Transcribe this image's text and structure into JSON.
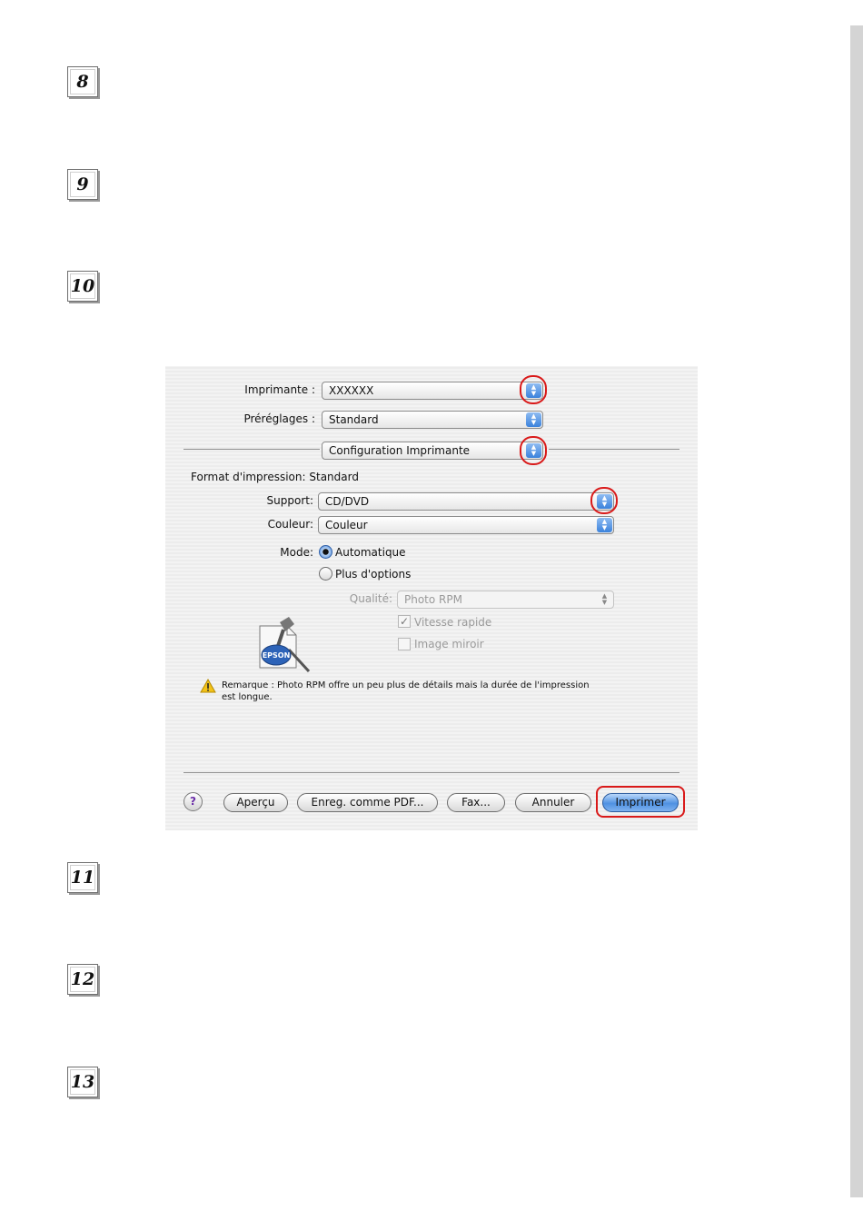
{
  "steps": {
    "s8": "8",
    "s9": "9",
    "s10": "10",
    "s11": "11",
    "s12": "12",
    "s13": "13"
  },
  "dialog": {
    "printer_label": "Imprimante :",
    "printer_value": "XXXXXX",
    "presets_label": "Préréglages :",
    "presets_value": "Standard",
    "panel_value": "Configuration Imprimante",
    "format_label": "Format d'impression:",
    "format_value": "Standard",
    "support_label": "Support:",
    "support_value": "CD/DVD",
    "color_label": "Couleur:",
    "color_value": "Couleur",
    "mode_label": "Mode:",
    "mode_auto": "Automatique",
    "mode_more": "Plus d'options",
    "quality_label": "Qualité:",
    "quality_value": "Photo RPM",
    "fast_label": "Vitesse rapide",
    "mirror_label": "Image miroir",
    "logo_text": "EPSON",
    "note_line1": "Remarque : Photo RPM offre un peu plus de détails mais la durée de l'impression",
    "note_line2": "est longue.",
    "help_label": "?",
    "btn_preview": "Aperçu",
    "btn_pdf": "Enreg. comme PDF...",
    "btn_fax": "Fax...",
    "btn_cancel": "Annuler",
    "btn_print": "Imprimer"
  },
  "colors": {
    "highlight": "#d91a1a",
    "accent": "#3b82dc"
  }
}
